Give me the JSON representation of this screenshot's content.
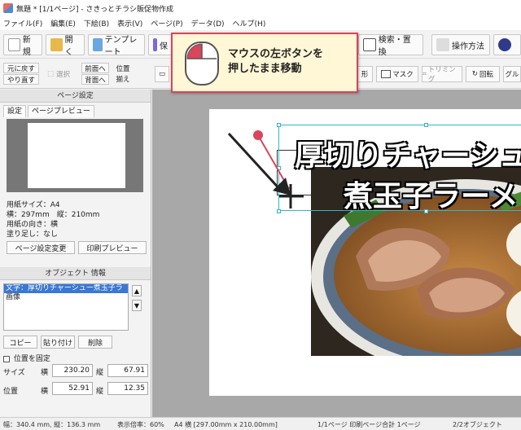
{
  "window": {
    "title": "無題 * [1/1ページ] - さきっとチラシ販促物作成"
  },
  "menu": [
    "ファイル(F)",
    "編集(E)",
    "下絵(B)",
    "表示(V)",
    "ページ(P)",
    "データ(D)",
    "ヘルプ(H)"
  ],
  "toolbar": {
    "new": "新規",
    "open": "開く",
    "template": "テンプレート",
    "save": "保",
    "search_replace": "検索・置換",
    "how_to": "操作方法"
  },
  "toolbar2": {
    "undo": "元に戻す",
    "redo": "やり直す",
    "select": "選択",
    "front": "前面へ",
    "back": "背面へ",
    "position": "位置",
    "align": "揃え",
    "shape": "形",
    "mask": "マスク",
    "trimming": "トリミング",
    "rotate": "回転",
    "group": "グル"
  },
  "page_settings": {
    "header": "ページ設定",
    "tab_settings": "設定",
    "tab_preview": "ページプレビュー",
    "paper_size": "用紙サイズ：A4",
    "dimensions": "横：297mm　縦：210mm",
    "orientation": "用紙の向き：横",
    "bleed": "塗り足し：なし",
    "change_button": "ページ設定変更",
    "print_preview_button": "印刷プレビュー"
  },
  "object_info": {
    "header": "オブジェクト 情報",
    "items": [
      "文字：厚切りチャーシュー煮玉子ラ",
      "画像"
    ],
    "copy": "コピー",
    "paste": "貼り付け",
    "delete": "削除",
    "lock_position": "位置を固定",
    "size_label": "サイズ",
    "position_label": "位置",
    "horiz": "横",
    "vert": "縦",
    "size_w": "230.20",
    "size_h": "67.91",
    "pos_x": "52.91",
    "pos_y": "12.35"
  },
  "canvas": {
    "headline_1": "厚切りチャーシュ",
    "headline_2": "煮玉子ラーメ"
  },
  "callout": {
    "line1": "マウスの左ボタンを",
    "line2": "押したまま移動"
  },
  "status": {
    "size": "幅：340.4 mm, 縦：136.3 mm",
    "zoom": "表示倍率：60%",
    "paper": "A4 横 [297.00mm x 210.00mm]",
    "pages": "1/1ページ 印刷ページ合計 1ページ",
    "objects": "2/2オブジェクト"
  },
  "colors": {
    "accent": "#3a78d4",
    "callout_border": "#d9455a",
    "selection": "#33b5c8"
  }
}
